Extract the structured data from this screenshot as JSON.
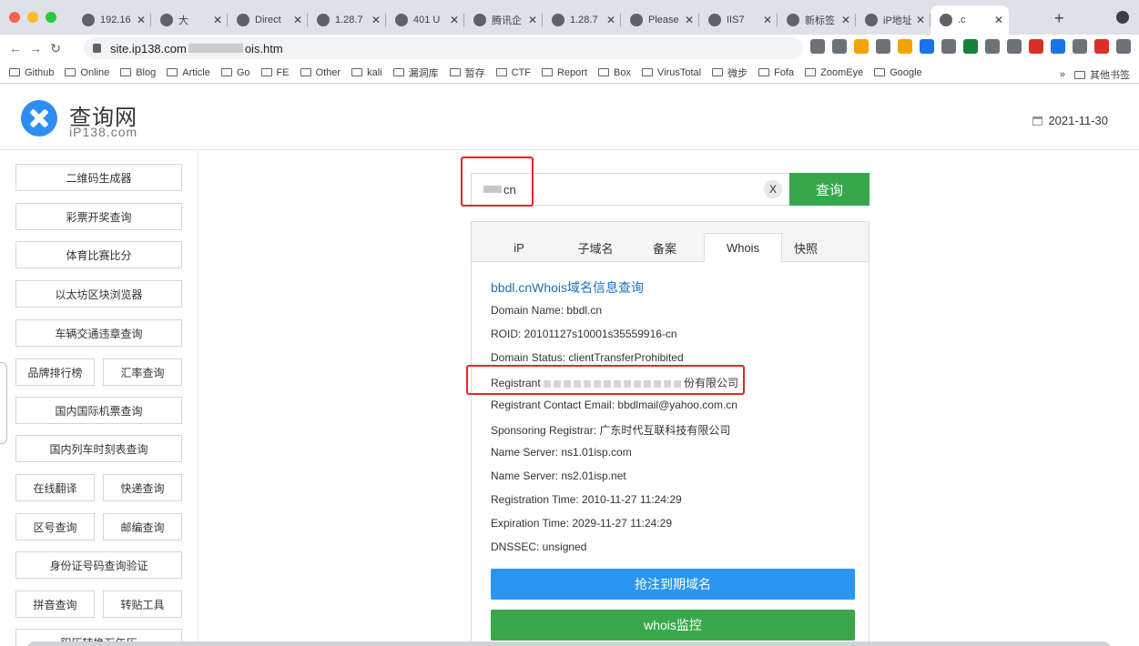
{
  "browser": {
    "tabs": [
      {
        "title": "192.16",
        "icon": "globe-icon"
      },
      {
        "title": "大",
        "icon": "site-icon"
      },
      {
        "title": "Direct",
        "icon": "globe-icon"
      },
      {
        "title": "1.28.7",
        "icon": "paw-icon"
      },
      {
        "title": "401 U",
        "icon": "globe-icon"
      },
      {
        "title": "腾讯企",
        "icon": "tencent-icon"
      },
      {
        "title": "1.28.7",
        "icon": "globe-icon"
      },
      {
        "title": "Please",
        "icon": "globe-icon"
      },
      {
        "title": "IIS7",
        "icon": "globe-icon"
      },
      {
        "title": "新标签",
        "icon": "newtab-icon"
      },
      {
        "title": "iP地址",
        "icon": "ip-icon"
      },
      {
        "title": ".c",
        "icon": "site-icon"
      }
    ],
    "url_prefix": "site.ip138.com",
    "url_suffix": "ois.htm",
    "bookmarks": [
      "Github",
      "Online",
      "Blog",
      "Article",
      "Go",
      "FE",
      "Other",
      "kali",
      "漏洞库",
      "暂存",
      "CTF",
      "Report",
      "Box",
      "VirusTotal",
      "微步",
      "Fofa",
      "ZoomEye",
      "Google"
    ],
    "bookmarks_more": "»",
    "other_bookmarks": "其他书签"
  },
  "site": {
    "logo_title": "查询网",
    "logo_sub": "iP138.com",
    "date": "2021-11-30"
  },
  "sidebar": {
    "full": [
      "二维码生成器",
      "彩票开奖查询",
      "体育比赛比分",
      "以太坊区块浏览器",
      "车辆交通违章查询",
      "国内国际机票查询",
      "国内列车时刻表查询",
      "身份证号码查询验证",
      "阳历转换万年历"
    ],
    "pairs": [
      [
        "品牌排行榜",
        "汇率查询"
      ],
      [
        "在线翻译",
        "快递查询"
      ],
      [
        "区号查询",
        "邮编查询"
      ],
      [
        "拼音查询",
        "转贴工具"
      ]
    ]
  },
  "search": {
    "value_suffix": "cn",
    "clear_label": "X",
    "button_label": "查询"
  },
  "panel": {
    "tabs": [
      "iP",
      "子域名",
      "备案",
      "Whois",
      "快照"
    ],
    "active_tab": "Whois",
    "title": "bbdl.cnWhois域名信息查询",
    "lines": [
      "Domain Name: bbdl.cn",
      "ROID: 20101127s10001s35559916-cn",
      "Domain Status: clientTransferProhibited",
      "Registrant Contact Email: bbdlmail@yahoo.com.cn",
      "Sponsoring Registrar: 广东时代互联科技有限公司",
      "Name Server: ns1.01isp.com",
      "Name Server: ns2.01isp.net",
      "Registration Time: 2010-11-27 11:24:29",
      "Expiration Time: 2029-11-27 11:24:29",
      "DNSSEC: unsigned"
    ],
    "registrant_label": "Registrant",
    "registrant_tail": "份有限公司",
    "btn_expire": "抢注到期域名",
    "btn_monitor": "whois监控"
  },
  "colors": {
    "search_button": "#36a84a",
    "blue_button": "#2b96f0",
    "green_button": "#3aa84a",
    "title_link": "#1e6fbf",
    "highlight": "#e3262a"
  }
}
